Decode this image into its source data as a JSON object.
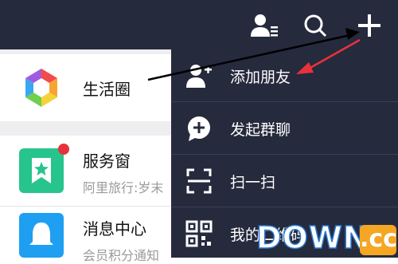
{
  "left_list": {
    "moments": {
      "title": "生活圈"
    },
    "service": {
      "title": "服务窗",
      "subtitle": "阿里旅行:岁末"
    },
    "messages": {
      "title": "消息中心",
      "subtitle": "会员积分通知"
    }
  },
  "dropdown_menu": {
    "items": [
      {
        "label": "添加朋友",
        "icon": "add-friend-icon"
      },
      {
        "label": "发起群聊",
        "icon": "group-chat-icon"
      },
      {
        "label": "扫一扫",
        "icon": "scan-icon"
      },
      {
        "label": "我的二维码",
        "icon": "qr-code-icon"
      }
    ]
  },
  "watermark": {
    "text": "DOWN",
    "suffix": ".cc"
  },
  "colors": {
    "topbar": "#262a3d",
    "menu_bg": "#262a3d",
    "arrow_red": "#e8323b",
    "service_green": "#27c48e",
    "message_blue": "#1e9ff2"
  }
}
